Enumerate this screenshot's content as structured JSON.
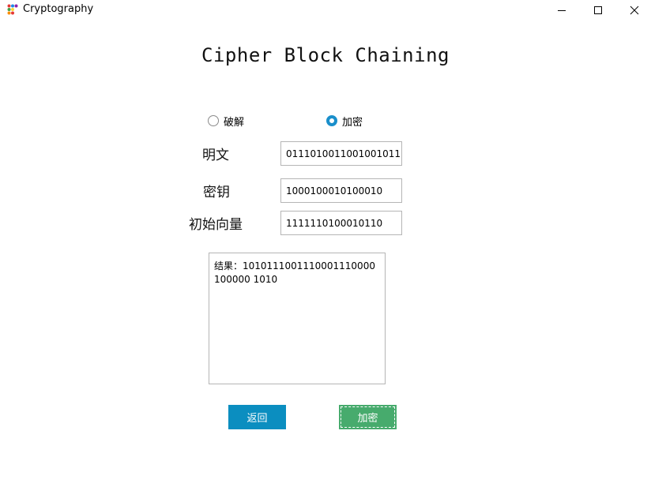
{
  "window": {
    "title": "Cryptography"
  },
  "heading": "Cipher Block Chaining",
  "mode": {
    "options": [
      {
        "label": "破解",
        "selected": false
      },
      {
        "label": "加密",
        "selected": true
      }
    ]
  },
  "fields": {
    "plaintext": {
      "label": "明文",
      "value": "0111010011001001011"
    },
    "key": {
      "label": "密钥",
      "value": "1000100010100010"
    },
    "iv": {
      "label": "初始向量",
      "value": "1111110100010110"
    }
  },
  "result": {
    "text": "结果：1010111001110001110000100000 1010"
  },
  "buttons": {
    "back": "返回",
    "encrypt": "加密"
  },
  "colors": {
    "accent_blue": "#0b8ec0",
    "accent_green": "#47ab6d",
    "radio_selected": "#1a8fcb"
  }
}
